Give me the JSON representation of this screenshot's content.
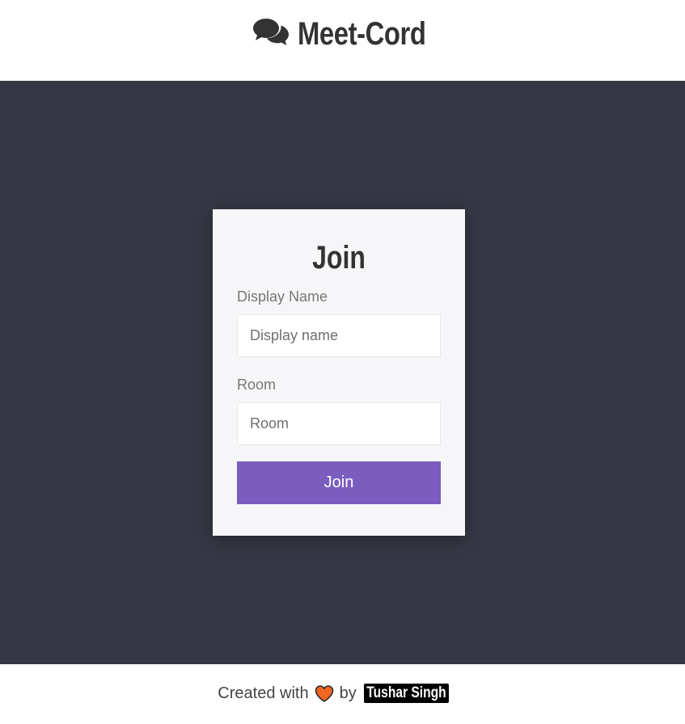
{
  "header": {
    "icon": "chat-bubbles-icon",
    "title": "Meet-Cord"
  },
  "join_form": {
    "title": "Join",
    "display_name_label": "Display Name",
    "display_name_placeholder": "Display name",
    "display_name_value": "",
    "room_label": "Room",
    "room_placeholder": "Room",
    "room_value": "",
    "submit_label": "Join"
  },
  "footer": {
    "created_with": "Created with",
    "heart_icon": "heart-icon",
    "by": "by",
    "author": "Tushar Singh"
  },
  "colors": {
    "page_background": "#353744",
    "card_background": "#f6f6f9",
    "button_background": "#7b5dbf",
    "heart": "#f26522",
    "text_dark": "#333333"
  }
}
